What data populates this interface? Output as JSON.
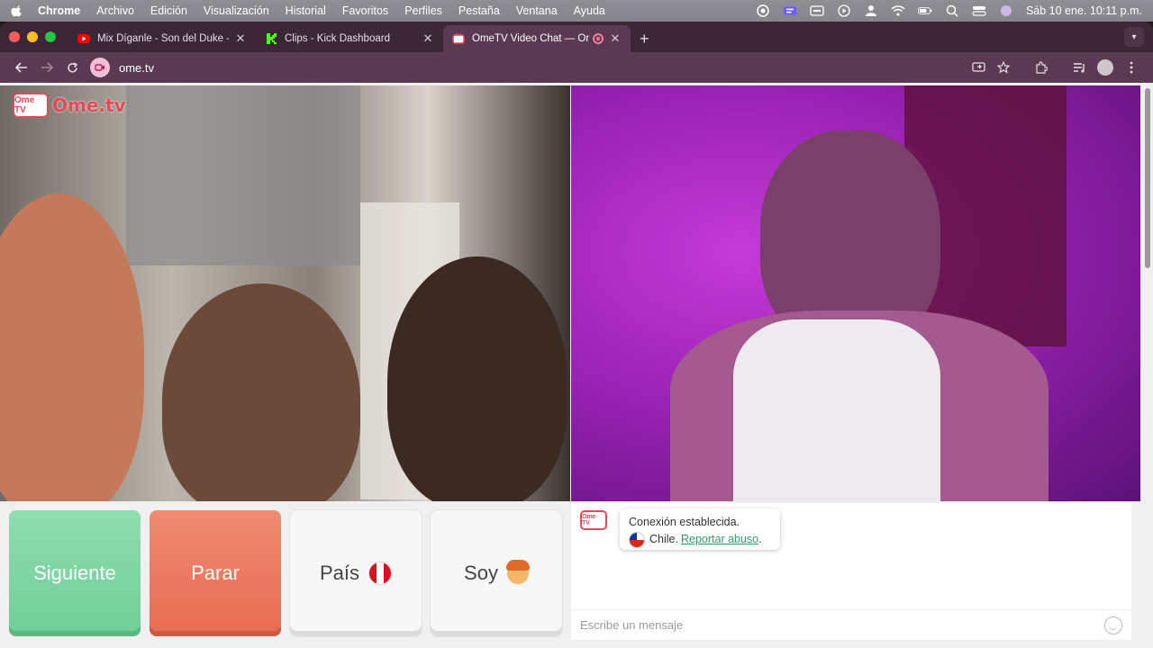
{
  "menubar": {
    "app": "Chrome",
    "items": [
      "Archivo",
      "Edición",
      "Visualización",
      "Historial",
      "Favoritos",
      "Perfiles",
      "Pestaña",
      "Ventana",
      "Ayuda"
    ],
    "clock": "Sáb 10 ene.  10:11 p.m."
  },
  "tabs": [
    {
      "title": "Mix Díganle - Son del Duke -",
      "favicon": "youtube-icon",
      "color": "#ff0000"
    },
    {
      "title": "Clips - Kick Dashboard",
      "favicon": "kick-icon",
      "color": "#53fc18"
    },
    {
      "title": "OmeTV Video Chat — Om",
      "favicon": "ometv-icon",
      "color": "#e24a57",
      "active": true
    }
  ],
  "address": {
    "url": "ome.tv"
  },
  "logo": {
    "tv": "Ome TV",
    "wordmark": "Ome.tv"
  },
  "controls": {
    "next_label": "Siguiente",
    "stop_label": "Parar",
    "country_label": "País",
    "gender_label": "Soy"
  },
  "chat": {
    "logo": "Ome TV",
    "status": "Conexión establecida.",
    "country": "Chile.",
    "report_link": "Reportar abuso",
    "report_suffix": ".",
    "input_placeholder": "Escribe un mensaje"
  },
  "colors": {
    "next": "#6fcf97",
    "stop": "#e86c52",
    "link": "#2e9c6a",
    "brand": "#e24a57"
  }
}
